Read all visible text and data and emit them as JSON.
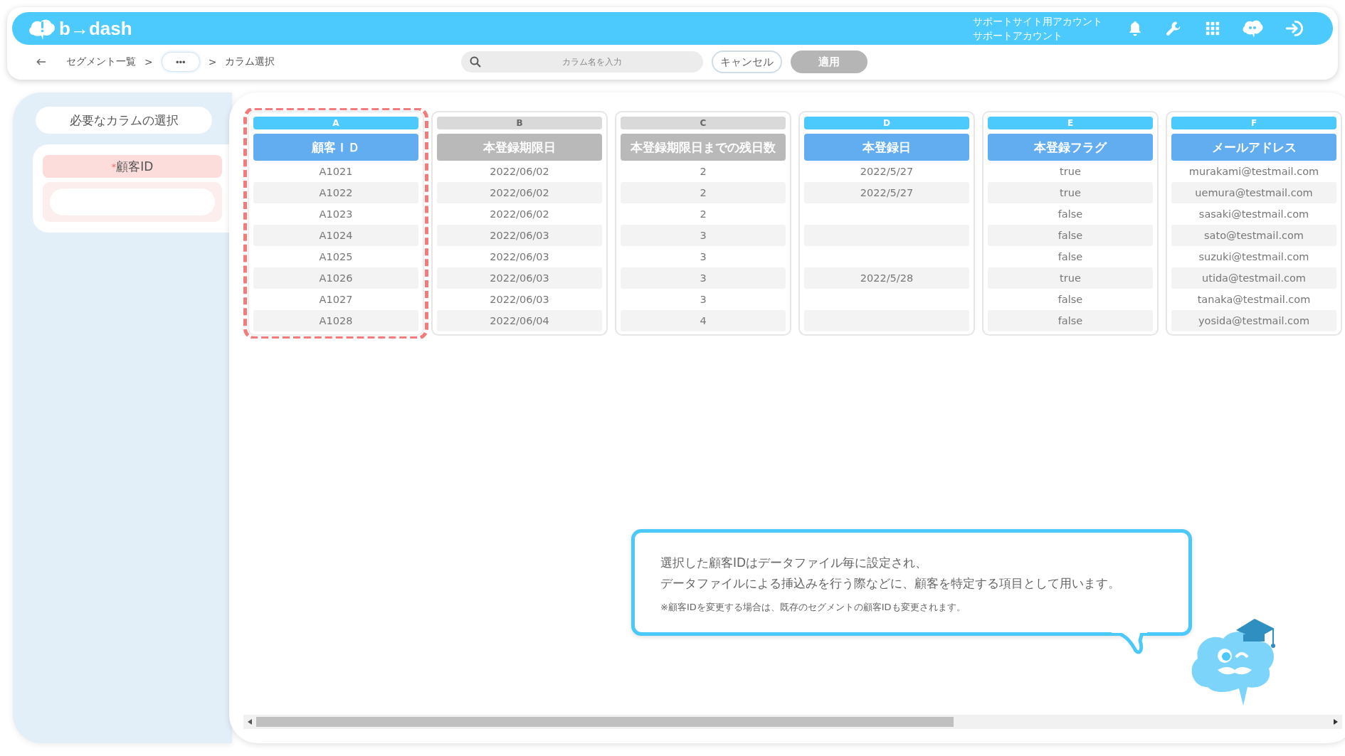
{
  "header": {
    "logo": "b→dash",
    "account_lines": [
      "サポートサイト用アカウント",
      "サポートアカウント"
    ]
  },
  "breadcrumb": {
    "items": [
      {
        "kind": "link",
        "label": "セグメント一覧"
      },
      {
        "kind": "separator",
        "label": ">"
      },
      {
        "kind": "more",
        "label": "•••"
      },
      {
        "kind": "separator",
        "label": ">"
      },
      {
        "kind": "current",
        "label": "カラム選択"
      }
    ]
  },
  "search": {
    "placeholder": "カラム名を入力"
  },
  "buttons": [
    {
      "label": "キャンセル",
      "disabled": false
    },
    {
      "label": "適用",
      "disabled": true
    }
  ],
  "sidebar": {
    "title": "必要なカラムの選択",
    "fields": [
      {
        "label": "$^{*}$顧客ID",
        "required": true
      }
    ]
  },
  "columns": [
    {
      "letter": "A",
      "header": "顧客ＩＤ",
      "selected": true,
      "focused": true,
      "cells": [
        "A1021",
        "A1022",
        "A1023",
        "A1024",
        "A1025",
        "A1026",
        "A1027",
        "A1028"
      ]
    },
    {
      "letter": "B",
      "header": "本登録期限日",
      "selected": false,
      "focused": false,
      "cells": [
        "2022/06/02",
        "2022/06/02",
        "2022/06/02",
        "2022/06/03",
        "2022/06/03",
        "2022/06/03",
        "2022/06/03",
        "2022/06/04"
      ]
    },
    {
      "letter": "C",
      "header": "本登録期限日までの残日数",
      "selected": false,
      "focused": false,
      "cells": [
        "2",
        "2",
        "2",
        "3",
        "3",
        "3",
        "3",
        "4"
      ]
    },
    {
      "letter": "D",
      "header": "本登録日",
      "selected": true,
      "focused": false,
      "cells": [
        "2022/5/27",
        "2022/5/27",
        "",
        "",
        "",
        "2022/5/28",
        "",
        ""
      ]
    },
    {
      "letter": "E",
      "header": "本登録フラグ",
      "selected": true,
      "focused": false,
      "cells": [
        "true",
        "true",
        "false",
        "false",
        "false",
        "true",
        "false",
        "false"
      ]
    },
    {
      "letter": "F",
      "header": "メールアドレス",
      "selected": true,
      "focused": false,
      "cells": [
        "murakami@testmail.com",
        "uemura@testmail.com",
        "sasaki@testmail.com",
        "sato@testmail.com",
        "suzuki@testmail.com",
        "utida@testmail.com",
        "tanaka@testmail.com",
        "yosida@testmail.com"
      ]
    }
  ],
  "tip": {
    "message_lines": [
      "選択した顧客IDはデータファイル毎に設定され、",
      "データファイルによる挿込みを行う際などに、顧客を特定する項目として用います。"
    ],
    "note": "※顧客IDを変更する場合は、既存のセグメントの顧客IDも変更されます。"
  }
}
